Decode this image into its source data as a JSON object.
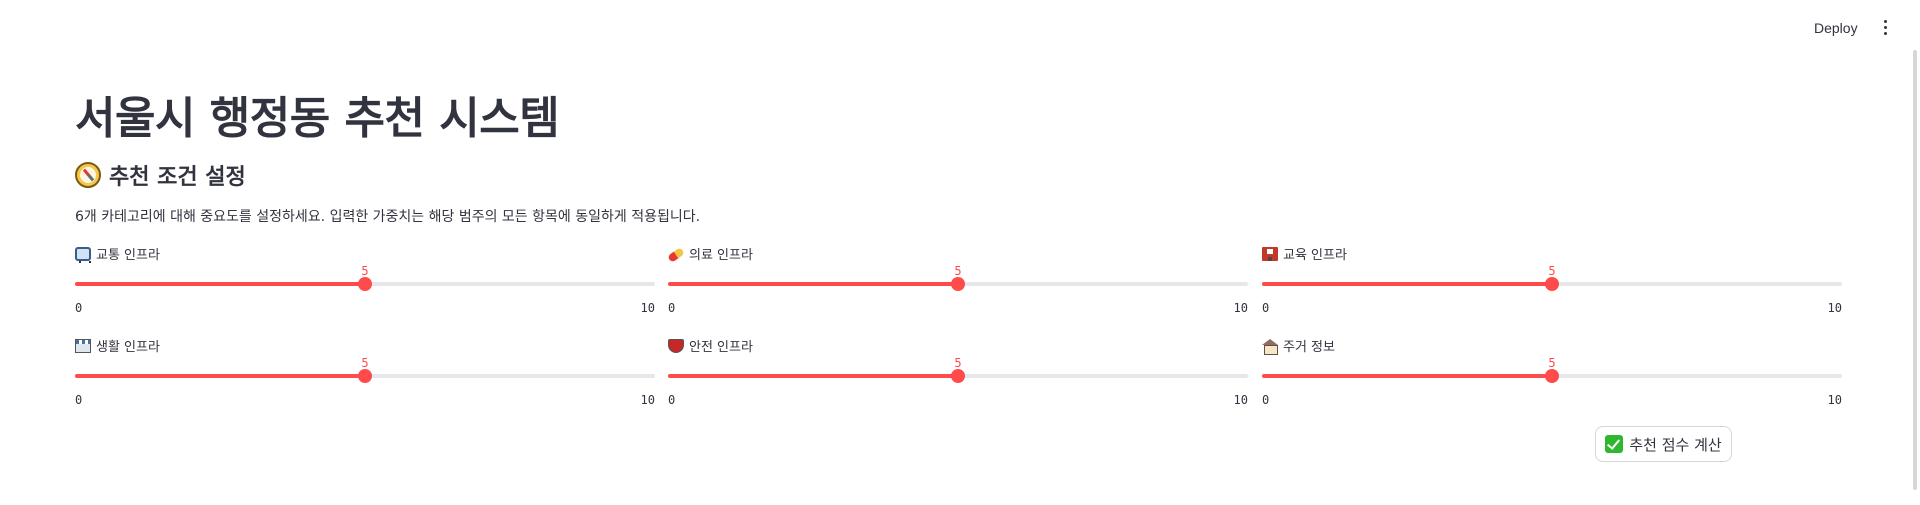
{
  "header": {
    "deploy_label": "Deploy",
    "menu_icon": "kebab-menu-icon"
  },
  "main": {
    "title": "서울시 행정동 추천 시스템",
    "section": {
      "icon": "compass-icon",
      "title": "추천 조건 설정"
    },
    "description": "6개 카테고리에 대해 중요도를 설정하세요. 입력한 가중치는 해당 범주의 모든 항목에 동일하게 적용됩니다.",
    "sliders": [
      {
        "icon": "bus-icon",
        "label": "교통 인프라",
        "value": 5,
        "min": 0,
        "max": 10,
        "value_text": "5",
        "min_text": "0",
        "max_text": "10"
      },
      {
        "icon": "pill-icon",
        "label": "의료 인프라",
        "value": 5,
        "min": 0,
        "max": 10,
        "value_text": "5",
        "min_text": "0",
        "max_text": "10"
      },
      {
        "icon": "school-icon",
        "label": "교육 인프라",
        "value": 5,
        "min": 0,
        "max": 10,
        "value_text": "5",
        "min_text": "0",
        "max_text": "10"
      },
      {
        "icon": "store-icon",
        "label": "생활 인프라",
        "value": 5,
        "min": 0,
        "max": 10,
        "value_text": "5",
        "min_text": "0",
        "max_text": "10"
      },
      {
        "icon": "shield-icon",
        "label": "안전 인프라",
        "value": 5,
        "min": 0,
        "max": 10,
        "value_text": "5",
        "min_text": "0",
        "max_text": "10"
      },
      {
        "icon": "house-icon",
        "label": "주거 정보",
        "value": 5,
        "min": 0,
        "max": 10,
        "value_text": "5",
        "min_text": "0",
        "max_text": "10"
      }
    ],
    "submit": {
      "icon": "check-mark-icon",
      "label": "추천 점수 계산"
    }
  },
  "colors": {
    "accent": "#ff4b4b",
    "track": "#e6e7eb",
    "text": "#31333f"
  }
}
